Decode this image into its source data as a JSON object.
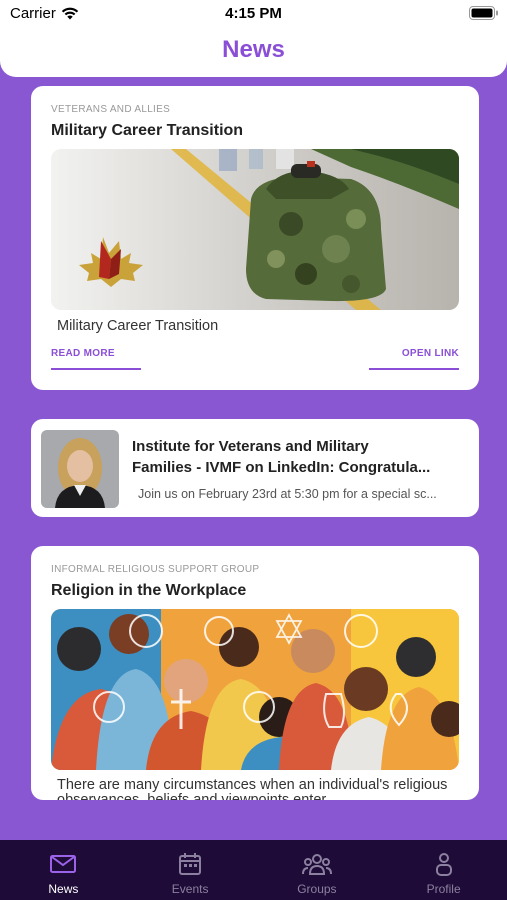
{
  "status_bar": {
    "carrier": "Carrier",
    "time": "4:15 PM"
  },
  "header": {
    "title": "News"
  },
  "cards": [
    {
      "category": "VETERANS AND ALLIES",
      "title": "Military Career Transition",
      "subtitle": "Military Career Transition",
      "read_more": "READ MORE",
      "open_link": "OPEN LINK"
    },
    {
      "title_line1": "Institute for Veterans and Military",
      "title_line2": "Families - IVMF on LinkedIn: Congratula...",
      "description": "Join us on February 23rd at 5:30 pm for a special sc..."
    },
    {
      "category": "INFORMAL RELIGIOUS SUPPORT GROUP",
      "title": "Religion in the Workplace",
      "description": "There are many circumstances when an individual's religious observances, beliefs and viewpoints enter"
    }
  ],
  "tabs": [
    {
      "label": "News",
      "icon": "mail-icon",
      "active": true
    },
    {
      "label": "Events",
      "icon": "calendar-icon",
      "active": false
    },
    {
      "label": "Groups",
      "icon": "groups-icon",
      "active": false
    },
    {
      "label": "Profile",
      "icon": "profile-icon",
      "active": false
    }
  ],
  "colors": {
    "accent": "#8a4fd6",
    "background": "#8a57d2",
    "tabbar": "#1e0b37"
  }
}
